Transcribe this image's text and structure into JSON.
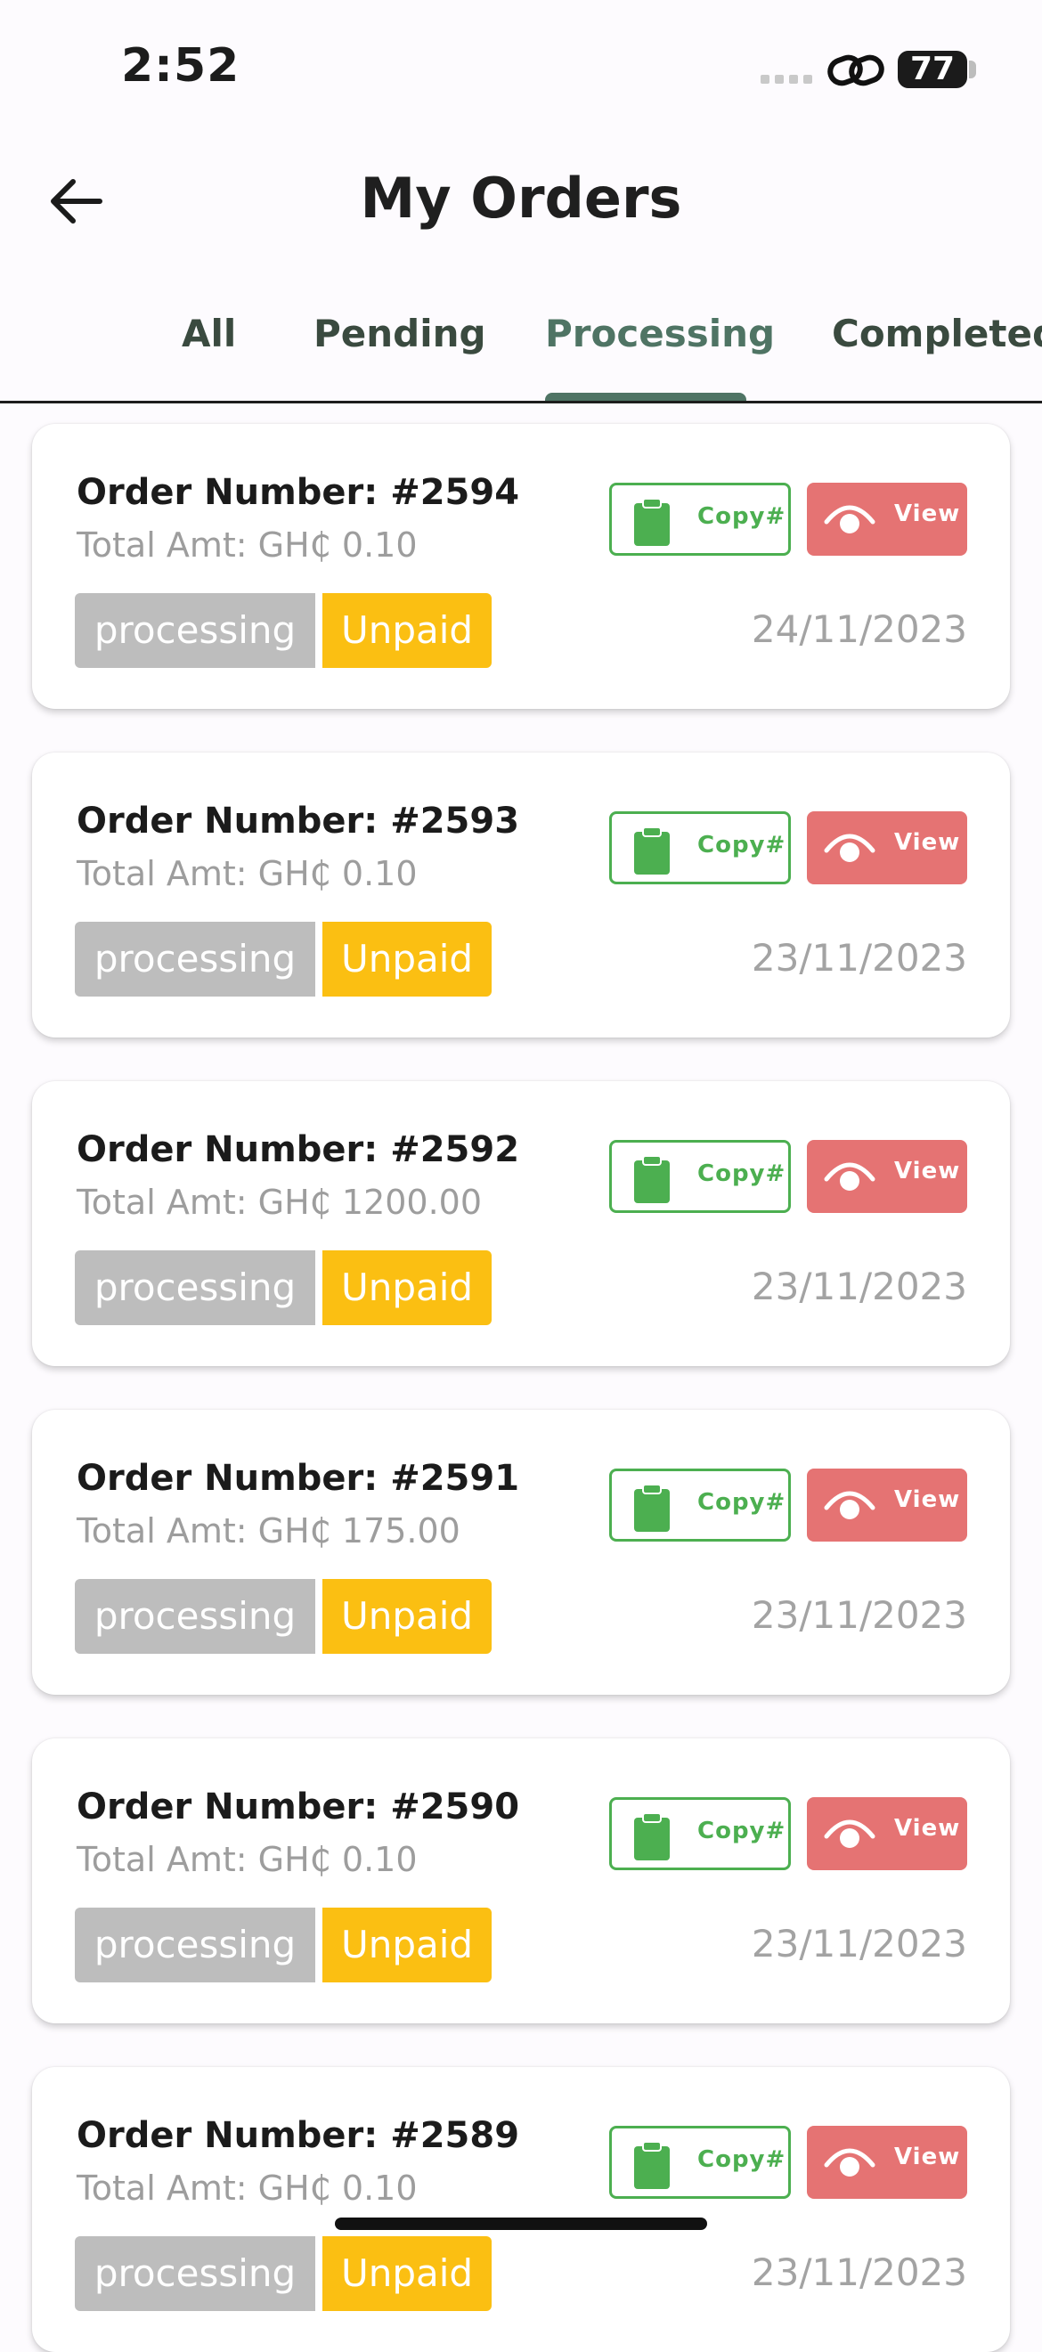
{
  "status_bar": {
    "time": "2:52",
    "battery": "77"
  },
  "header": {
    "title": "My Orders"
  },
  "tabs": [
    {
      "label": "All",
      "active": false
    },
    {
      "label": "Pending",
      "active": false
    },
    {
      "label": "Processing",
      "active": true
    },
    {
      "label": "Completed",
      "active": false
    }
  ],
  "orders": [
    {
      "order_number": "Order Number: #2594",
      "total": "Total Amt: GH₵ 0.10",
      "status": "processing",
      "payment": "Unpaid",
      "date": "24/11/2023",
      "copy_label": "Copy#",
      "view_label": "View"
    },
    {
      "order_number": "Order Number: #2593",
      "total": "Total Amt: GH₵ 0.10",
      "status": "processing",
      "payment": "Unpaid",
      "date": "23/11/2023",
      "copy_label": "Copy#",
      "view_label": "View"
    },
    {
      "order_number": "Order Number: #2592",
      "total": "Total Amt: GH₵ 1200.00",
      "status": "processing",
      "payment": "Unpaid",
      "date": "23/11/2023",
      "copy_label": "Copy#",
      "view_label": "View"
    },
    {
      "order_number": "Order Number: #2591",
      "total": "Total Amt: GH₵ 175.00",
      "status": "processing",
      "payment": "Unpaid",
      "date": "23/11/2023",
      "copy_label": "Copy#",
      "view_label": "View"
    },
    {
      "order_number": "Order Number: #2590",
      "total": "Total Amt: GH₵ 0.10",
      "status": "processing",
      "payment": "Unpaid",
      "date": "23/11/2023",
      "copy_label": "Copy#",
      "view_label": "View"
    },
    {
      "order_number": "Order Number: #2589",
      "total": "Total Amt: GH₵ 0.10",
      "status": "processing",
      "payment": "Unpaid",
      "date": "23/11/2023",
      "copy_label": "Copy#",
      "view_label": "View"
    }
  ],
  "colors": {
    "accent_tab": "#4f7464",
    "copy_green": "#4caf50",
    "view_red": "#e57373",
    "unpaid_yellow": "#fbbf12",
    "status_gray": "#bdbdbd"
  }
}
